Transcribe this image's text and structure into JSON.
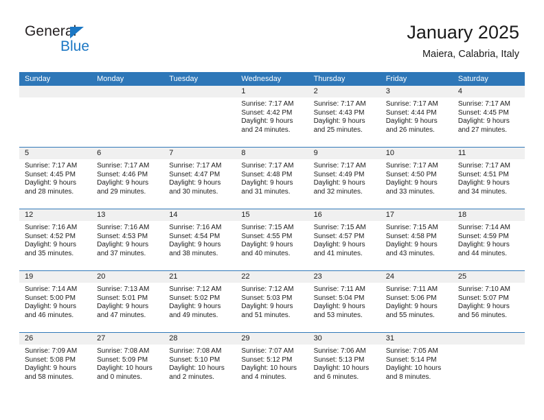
{
  "brand": {
    "name_top": "General",
    "name_bottom": "Blue",
    "color_primary": "#1b77c4",
    "color_text": "#231f20"
  },
  "header": {
    "title": "January 2025",
    "subtitle": "Maiera, Calabria, Italy"
  },
  "theme": {
    "header_blue": "#2e77b8",
    "daynum_band": "#f0f0f0",
    "text": "#1a1a1a"
  },
  "weekdays": [
    "Sunday",
    "Monday",
    "Tuesday",
    "Wednesday",
    "Thursday",
    "Friday",
    "Saturday"
  ],
  "weeks": [
    [
      {
        "day": "",
        "sunrise": "",
        "sunset": "",
        "daylight_1": "",
        "daylight_2": ""
      },
      {
        "day": "",
        "sunrise": "",
        "sunset": "",
        "daylight_1": "",
        "daylight_2": ""
      },
      {
        "day": "",
        "sunrise": "",
        "sunset": "",
        "daylight_1": "",
        "daylight_2": ""
      },
      {
        "day": "1",
        "sunrise": "Sunrise: 7:17 AM",
        "sunset": "Sunset: 4:42 PM",
        "daylight_1": "Daylight: 9 hours",
        "daylight_2": "and 24 minutes."
      },
      {
        "day": "2",
        "sunrise": "Sunrise: 7:17 AM",
        "sunset": "Sunset: 4:43 PM",
        "daylight_1": "Daylight: 9 hours",
        "daylight_2": "and 25 minutes."
      },
      {
        "day": "3",
        "sunrise": "Sunrise: 7:17 AM",
        "sunset": "Sunset: 4:44 PM",
        "daylight_1": "Daylight: 9 hours",
        "daylight_2": "and 26 minutes."
      },
      {
        "day": "4",
        "sunrise": "Sunrise: 7:17 AM",
        "sunset": "Sunset: 4:45 PM",
        "daylight_1": "Daylight: 9 hours",
        "daylight_2": "and 27 minutes."
      }
    ],
    [
      {
        "day": "5",
        "sunrise": "Sunrise: 7:17 AM",
        "sunset": "Sunset: 4:45 PM",
        "daylight_1": "Daylight: 9 hours",
        "daylight_2": "and 28 minutes."
      },
      {
        "day": "6",
        "sunrise": "Sunrise: 7:17 AM",
        "sunset": "Sunset: 4:46 PM",
        "daylight_1": "Daylight: 9 hours",
        "daylight_2": "and 29 minutes."
      },
      {
        "day": "7",
        "sunrise": "Sunrise: 7:17 AM",
        "sunset": "Sunset: 4:47 PM",
        "daylight_1": "Daylight: 9 hours",
        "daylight_2": "and 30 minutes."
      },
      {
        "day": "8",
        "sunrise": "Sunrise: 7:17 AM",
        "sunset": "Sunset: 4:48 PM",
        "daylight_1": "Daylight: 9 hours",
        "daylight_2": "and 31 minutes."
      },
      {
        "day": "9",
        "sunrise": "Sunrise: 7:17 AM",
        "sunset": "Sunset: 4:49 PM",
        "daylight_1": "Daylight: 9 hours",
        "daylight_2": "and 32 minutes."
      },
      {
        "day": "10",
        "sunrise": "Sunrise: 7:17 AM",
        "sunset": "Sunset: 4:50 PM",
        "daylight_1": "Daylight: 9 hours",
        "daylight_2": "and 33 minutes."
      },
      {
        "day": "11",
        "sunrise": "Sunrise: 7:17 AM",
        "sunset": "Sunset: 4:51 PM",
        "daylight_1": "Daylight: 9 hours",
        "daylight_2": "and 34 minutes."
      }
    ],
    [
      {
        "day": "12",
        "sunrise": "Sunrise: 7:16 AM",
        "sunset": "Sunset: 4:52 PM",
        "daylight_1": "Daylight: 9 hours",
        "daylight_2": "and 35 minutes."
      },
      {
        "day": "13",
        "sunrise": "Sunrise: 7:16 AM",
        "sunset": "Sunset: 4:53 PM",
        "daylight_1": "Daylight: 9 hours",
        "daylight_2": "and 37 minutes."
      },
      {
        "day": "14",
        "sunrise": "Sunrise: 7:16 AM",
        "sunset": "Sunset: 4:54 PM",
        "daylight_1": "Daylight: 9 hours",
        "daylight_2": "and 38 minutes."
      },
      {
        "day": "15",
        "sunrise": "Sunrise: 7:15 AM",
        "sunset": "Sunset: 4:55 PM",
        "daylight_1": "Daylight: 9 hours",
        "daylight_2": "and 40 minutes."
      },
      {
        "day": "16",
        "sunrise": "Sunrise: 7:15 AM",
        "sunset": "Sunset: 4:57 PM",
        "daylight_1": "Daylight: 9 hours",
        "daylight_2": "and 41 minutes."
      },
      {
        "day": "17",
        "sunrise": "Sunrise: 7:15 AM",
        "sunset": "Sunset: 4:58 PM",
        "daylight_1": "Daylight: 9 hours",
        "daylight_2": "and 43 minutes."
      },
      {
        "day": "18",
        "sunrise": "Sunrise: 7:14 AM",
        "sunset": "Sunset: 4:59 PM",
        "daylight_1": "Daylight: 9 hours",
        "daylight_2": "and 44 minutes."
      }
    ],
    [
      {
        "day": "19",
        "sunrise": "Sunrise: 7:14 AM",
        "sunset": "Sunset: 5:00 PM",
        "daylight_1": "Daylight: 9 hours",
        "daylight_2": "and 46 minutes."
      },
      {
        "day": "20",
        "sunrise": "Sunrise: 7:13 AM",
        "sunset": "Sunset: 5:01 PM",
        "daylight_1": "Daylight: 9 hours",
        "daylight_2": "and 47 minutes."
      },
      {
        "day": "21",
        "sunrise": "Sunrise: 7:12 AM",
        "sunset": "Sunset: 5:02 PM",
        "daylight_1": "Daylight: 9 hours",
        "daylight_2": "and 49 minutes."
      },
      {
        "day": "22",
        "sunrise": "Sunrise: 7:12 AM",
        "sunset": "Sunset: 5:03 PM",
        "daylight_1": "Daylight: 9 hours",
        "daylight_2": "and 51 minutes."
      },
      {
        "day": "23",
        "sunrise": "Sunrise: 7:11 AM",
        "sunset": "Sunset: 5:04 PM",
        "daylight_1": "Daylight: 9 hours",
        "daylight_2": "and 53 minutes."
      },
      {
        "day": "24",
        "sunrise": "Sunrise: 7:11 AM",
        "sunset": "Sunset: 5:06 PM",
        "daylight_1": "Daylight: 9 hours",
        "daylight_2": "and 55 minutes."
      },
      {
        "day": "25",
        "sunrise": "Sunrise: 7:10 AM",
        "sunset": "Sunset: 5:07 PM",
        "daylight_1": "Daylight: 9 hours",
        "daylight_2": "and 56 minutes."
      }
    ],
    [
      {
        "day": "26",
        "sunrise": "Sunrise: 7:09 AM",
        "sunset": "Sunset: 5:08 PM",
        "daylight_1": "Daylight: 9 hours",
        "daylight_2": "and 58 minutes."
      },
      {
        "day": "27",
        "sunrise": "Sunrise: 7:08 AM",
        "sunset": "Sunset: 5:09 PM",
        "daylight_1": "Daylight: 10 hours",
        "daylight_2": "and 0 minutes."
      },
      {
        "day": "28",
        "sunrise": "Sunrise: 7:08 AM",
        "sunset": "Sunset: 5:10 PM",
        "daylight_1": "Daylight: 10 hours",
        "daylight_2": "and 2 minutes."
      },
      {
        "day": "29",
        "sunrise": "Sunrise: 7:07 AM",
        "sunset": "Sunset: 5:12 PM",
        "daylight_1": "Daylight: 10 hours",
        "daylight_2": "and 4 minutes."
      },
      {
        "day": "30",
        "sunrise": "Sunrise: 7:06 AM",
        "sunset": "Sunset: 5:13 PM",
        "daylight_1": "Daylight: 10 hours",
        "daylight_2": "and 6 minutes."
      },
      {
        "day": "31",
        "sunrise": "Sunrise: 7:05 AM",
        "sunset": "Sunset: 5:14 PM",
        "daylight_1": "Daylight: 10 hours",
        "daylight_2": "and 8 minutes."
      },
      {
        "day": "",
        "sunrise": "",
        "sunset": "",
        "daylight_1": "",
        "daylight_2": ""
      }
    ]
  ]
}
